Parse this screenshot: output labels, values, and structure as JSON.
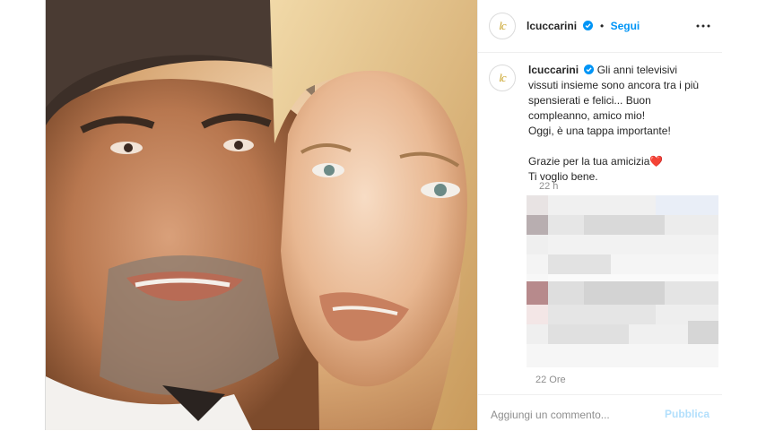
{
  "account": {
    "username": "lcuccarini",
    "avatar_text": "lc",
    "follow_label": "Segui"
  },
  "caption": {
    "paragraphs": [
      "Gli anni televisivi vissuti insieme sono ancora tra i più spensierati e felici... Buon compleanno, amico mio!",
      "Oggi, è una tappa importante!",
      "",
      "Grazie per la tua amicizia❤️",
      "Ti voglio bene."
    ],
    "time": "22 h"
  },
  "comments": {
    "partial_timestamp": "22 Ore"
  },
  "composer": {
    "placeholder": "Aggiungi un commento...",
    "publish_label": "Pubblica"
  },
  "icons": {
    "verified": "verified-badge-icon",
    "more": "more-options-icon"
  },
  "colors": {
    "link_blue": "#0095f6",
    "publish_disabled": "#b2dffc",
    "brand_gold": "#c9a227"
  }
}
